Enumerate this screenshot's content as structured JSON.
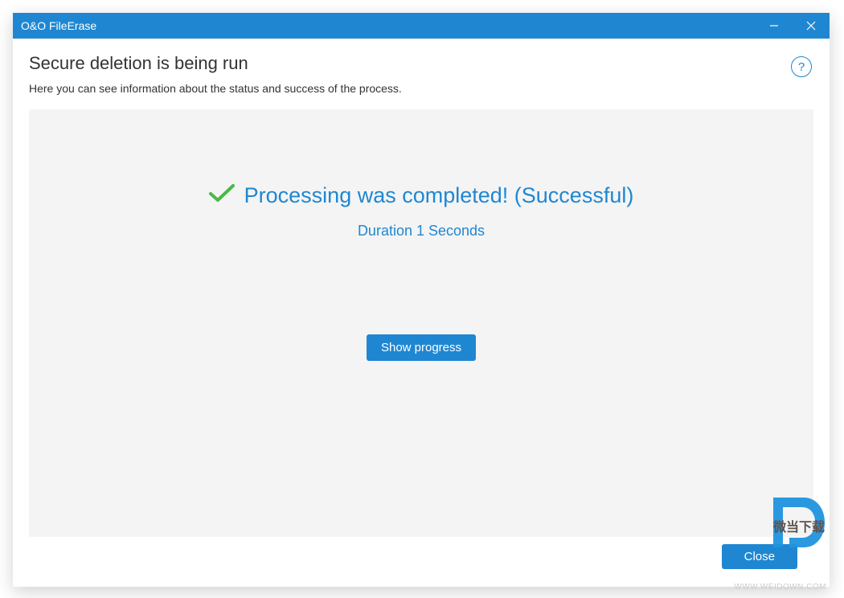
{
  "titlebar": {
    "title": "O&O FileErase"
  },
  "header": {
    "title": "Secure deletion is being run",
    "subtitle": "Here you can see information about the status and success of the process."
  },
  "help": {
    "label": "?"
  },
  "status": {
    "message": "Processing was completed! (Successful)",
    "duration": "Duration 1 Seconds"
  },
  "buttons": {
    "show_progress": "Show progress",
    "close": "Close"
  },
  "watermark": {
    "text": "微当下载",
    "url": "WWW.WEIDOWN.COM"
  }
}
